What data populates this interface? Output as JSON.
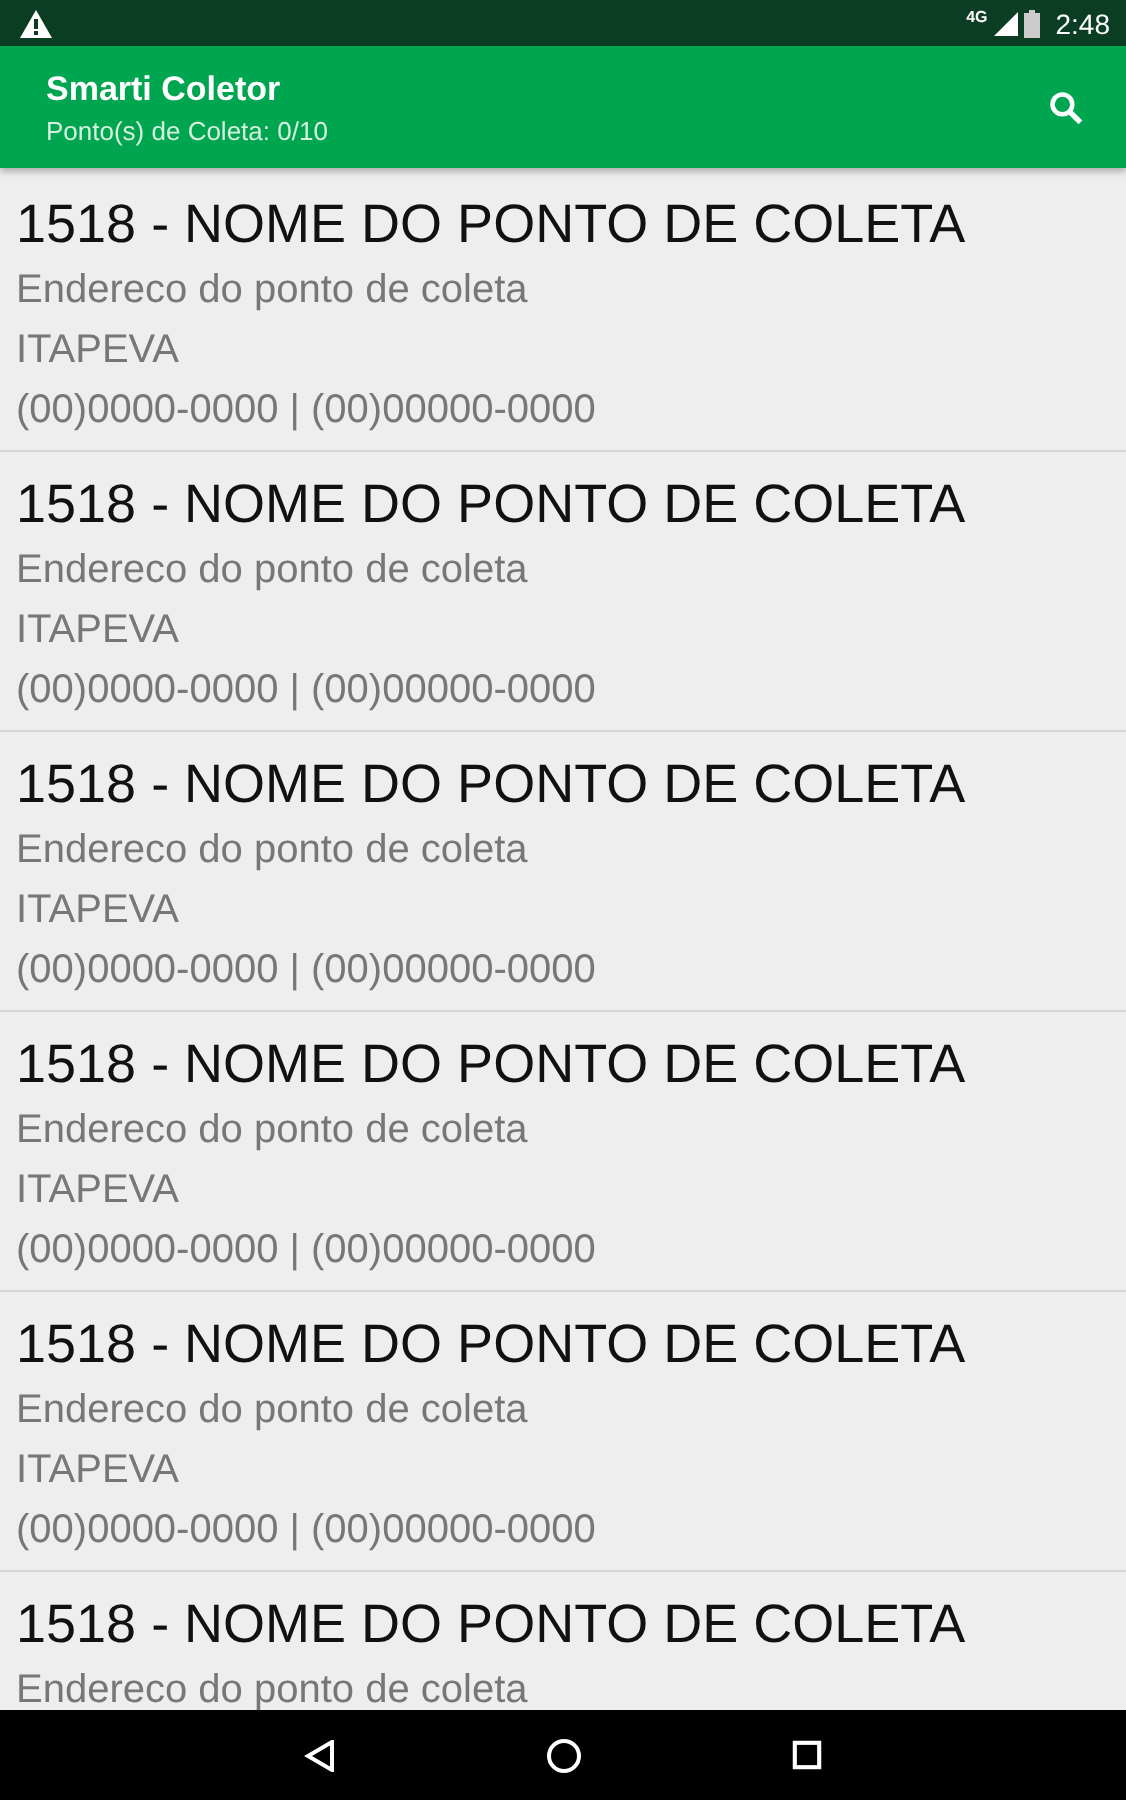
{
  "status_bar": {
    "time": "2:48",
    "network": "4G"
  },
  "app_bar": {
    "title": "Smarti Coletor",
    "subtitle": "Ponto(s) de Coleta: 0/10"
  },
  "items": [
    {
      "title": "1518 - NOME DO PONTO DE COLETA",
      "address": "Endereco do ponto de coleta",
      "city": "ITAPEVA",
      "phones": "(00)0000-0000 | (00)00000-0000"
    },
    {
      "title": "1518 - NOME DO PONTO DE COLETA",
      "address": "Endereco do ponto de coleta",
      "city": "ITAPEVA",
      "phones": "(00)0000-0000 | (00)00000-0000"
    },
    {
      "title": "1518 - NOME DO PONTO DE COLETA",
      "address": "Endereco do ponto de coleta",
      "city": "ITAPEVA",
      "phones": "(00)0000-0000 | (00)00000-0000"
    },
    {
      "title": "1518 - NOME DO PONTO DE COLETA",
      "address": "Endereco do ponto de coleta",
      "city": "ITAPEVA",
      "phones": "(00)0000-0000 | (00)00000-0000"
    },
    {
      "title": "1518 - NOME DO PONTO DE COLETA",
      "address": "Endereco do ponto de coleta",
      "city": "ITAPEVA",
      "phones": "(00)0000-0000 | (00)00000-0000"
    },
    {
      "title": "1518 - NOME DO PONTO DE COLETA",
      "address": "Endereco do ponto de coleta"
    }
  ]
}
